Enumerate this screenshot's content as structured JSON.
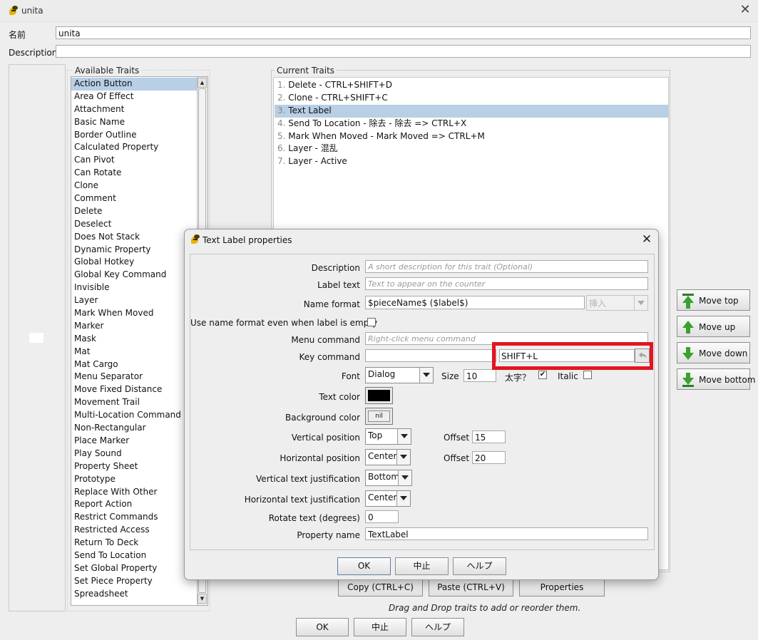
{
  "window": {
    "title": "unita",
    "close_glyph": "✕",
    "name_label": "名前",
    "name_value": "unita",
    "description_label": "Description",
    "description_value": ""
  },
  "available_traits": {
    "legend": "Available Traits",
    "selected_index": 0,
    "items": [
      "Action Button",
      "Area Of Effect",
      "Attachment",
      "Basic Name",
      "Border Outline",
      "Calculated Property",
      "Can Pivot",
      "Can Rotate",
      "Clone",
      "Comment",
      "Delete",
      "Deselect",
      "Does Not Stack",
      "Dynamic Property",
      "Global Hotkey",
      "Global Key Command",
      "Invisible",
      "Layer",
      "Mark When Moved",
      "Marker",
      "Mask",
      "Mat",
      "Mat Cargo",
      "Menu Separator",
      "Move Fixed Distance",
      "Movement Trail",
      "Multi-Location Command",
      "Non-Rectangular",
      "Place Marker",
      "Play Sound",
      "Property Sheet",
      "Prototype",
      "Replace With Other",
      "Report Action",
      "Restrict Commands",
      "Restricted Access",
      "Return To Deck",
      "Send To Location",
      "Set Global Property",
      "Set Piece Property",
      "Spreadsheet"
    ]
  },
  "current_traits": {
    "legend": "Current Traits",
    "selected_index": 2,
    "items": [
      {
        "num": "1.",
        "text": "Delete - CTRL+SHIFT+D"
      },
      {
        "num": "2.",
        "text": "Clone - CTRL+SHIFT+C"
      },
      {
        "num": "3.",
        "text": "Text Label"
      },
      {
        "num": "4.",
        "text": "Send To Location - 除去 - 除去 => CTRL+X"
      },
      {
        "num": "5.",
        "text": "Mark When Moved - Mark Moved => CTRL+M"
      },
      {
        "num": "6.",
        "text": "Layer - 混乱"
      },
      {
        "num": "7.",
        "text": "Layer - Active"
      }
    ]
  },
  "side_buttons": {
    "move_top": "Move top",
    "move_up": "Move up",
    "move_down": "Move down",
    "move_bottom": "Move bottom"
  },
  "bottom": {
    "copy": "Copy (CTRL+C)",
    "paste": "Paste (CTRL+V)",
    "properties": "Properties",
    "hint": "Drag and Drop traits to add or reorder them.",
    "ok": "OK",
    "cancel": "中止",
    "help": "ヘルプ"
  },
  "dialog": {
    "title": "Text Label properties",
    "close_glyph": "✕",
    "description_label": "Description",
    "description_placeholder": "A short description for this trait (Optional)",
    "label_text_label": "Label text",
    "label_text_placeholder": "Text to appear on the counter",
    "name_format_label": "Name format",
    "name_format_value": "$pieceName$ ($label$)",
    "insert_label": "挿入",
    "use_name_format_label": "Use name format even when label is empty",
    "use_name_format_checked": false,
    "menu_command_label": "Menu command",
    "menu_command_placeholder": "Right-click menu command",
    "key_command_label": "Key command",
    "key_command_value": "SHIFT+L",
    "font_label": "Font",
    "font_value": "Dialog",
    "size_label": "Size",
    "size_value": "10",
    "bold_label": "太字？",
    "bold_checked": true,
    "italic_label": "Italic",
    "italic_checked": false,
    "text_color_label": "Text color",
    "text_color": "#000000",
    "background_color_label": "Background color",
    "background_color_value": "nil",
    "vertical_position_label": "Vertical position",
    "vertical_position_value": "Top",
    "offset_label": "Offset",
    "vertical_offset_value": "15",
    "horizontal_position_label": "Horizontal position",
    "horizontal_position_value": "Center",
    "horizontal_offset_value": "20",
    "vertical_justification_label": "Vertical text justification",
    "vertical_justification_value": "Bottom",
    "horizontal_justification_label": "Horizontal text justification",
    "horizontal_justification_value": "Center",
    "rotate_label": "Rotate text (degrees)",
    "rotate_value": "0",
    "property_name_label": "Property name",
    "property_name_value": "TextLabel",
    "ok": "OK",
    "cancel": "中止",
    "help": "ヘルプ"
  },
  "highlight_color": "#e3141f"
}
